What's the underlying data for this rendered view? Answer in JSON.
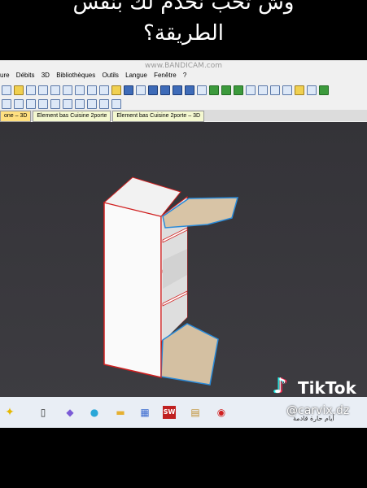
{
  "overlay_caption": {
    "line1": "وش تحب نخدم لك بنفس",
    "line2": "الطريقة؟"
  },
  "recorder_watermark": "www.BANDICAM.com",
  "menu": [
    "ure",
    "Débits",
    "3D",
    "Bibliothèques",
    "Outils",
    "Langue",
    "Fenêtre",
    "?"
  ],
  "tabs": [
    {
      "label": "one – 3D",
      "active": true
    },
    {
      "label": "Element bas Cuisine 2porte",
      "active": false
    },
    {
      "label": "Element bas Cuisine 2porte – 3D",
      "active": false
    }
  ],
  "colors": {
    "viewport": "#3a393e",
    "panel_white": "#ffffff",
    "edge_red": "#d02020",
    "edge_blue": "#2a8ad8",
    "wood": "#d8c4a6"
  },
  "taskbar": {
    "icons": [
      "sparkle-icon",
      "task-view-icon",
      "copilot-icon",
      "edge-icon",
      "file-explorer-icon",
      "store-icon",
      "solidworks-icon",
      "app-icon",
      "record-icon"
    ],
    "sw_label": "SW",
    "weather": "أيام حارة قادمة"
  },
  "tiktok": {
    "brand": "TikTok",
    "handle": "@carvix.dz"
  }
}
